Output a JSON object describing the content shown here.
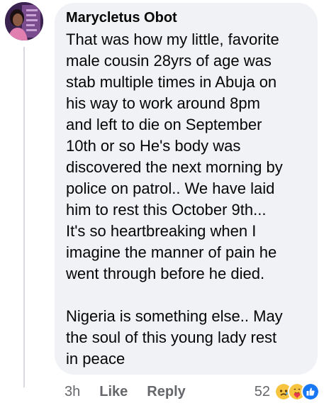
{
  "comment": {
    "author": "Marycletus Obot",
    "body_lines": [
      "That was how my little, favorite",
      "male cousin 28yrs of age was",
      "stab multiple times in Abuja on",
      "his way to work around 8pm",
      "and left to die on September",
      "10th or so He's body was",
      "discovered the next morning by",
      "police on patrol..  We have laid",
      "him to rest this October 9th...",
      "It's so heartbreaking when I",
      "imagine the manner of pain he",
      "went through before he died."
    ],
    "body_lines_2": [
      "Nigeria is something else.. May",
      "the soul of this young lady rest",
      "in peace"
    ],
    "time": "3h",
    "like_label": "Like",
    "reply_label": "Reply",
    "reaction_count": "52",
    "reaction_icons": [
      "sad-reaction-icon",
      "care-reaction-icon",
      "like-reaction-icon"
    ]
  }
}
